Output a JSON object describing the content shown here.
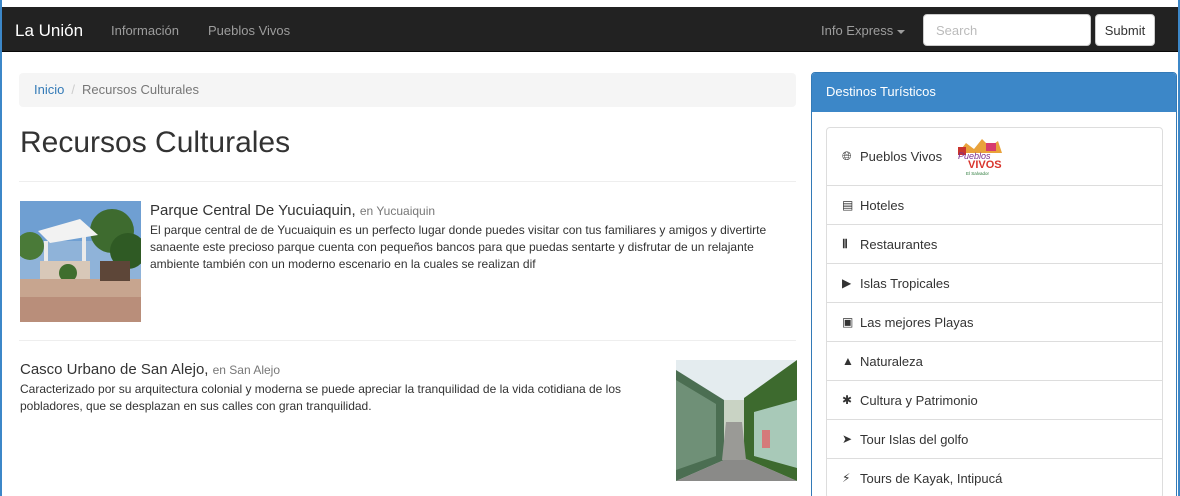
{
  "navbar": {
    "brand": "La Unión",
    "links": [
      "Información",
      "Pueblos Vivos"
    ],
    "dropdown": "Info Express",
    "search_placeholder": "Search",
    "submit": "Submit"
  },
  "breadcrumb": {
    "home": "Inicio",
    "current": "Recursos Culturales"
  },
  "page_title": "Recursos Culturales",
  "items": [
    {
      "title": "Parque Central De Yucuiaquin,",
      "location": "en Yucuaiquin",
      "description": "El parque central de de Yucuaiquin es un perfecto lugar donde puedes visitar con tus familiares y amigos y divertirte sanaente este precioso parque cuenta con pequeños bancos para que puedas sentarte y disfrutar de un relajante ambiente también con un moderno escenario en la cuales se realizan dif"
    },
    {
      "title": "Casco Urbano de San Alejo,",
      "location": "en San Alejo",
      "description": "Caracterizado por su arquitectura colonial y moderna se puede apreciar la tranquilidad de la vida cotidiana de los pobladores, que se desplazan en sus calles con gran tranquilidad."
    }
  ],
  "sidebar": {
    "heading": "Destinos Turísticos",
    "items": [
      {
        "label": "Pueblos Vivos",
        "icon": "globe-icon"
      },
      {
        "label": "Hoteles",
        "icon": "list-alt-icon"
      },
      {
        "label": "Restaurantes",
        "icon": "cutlery-icon"
      },
      {
        "label": "Islas Tropicales",
        "icon": "tags-icon"
      },
      {
        "label": "Las mejores Playas",
        "icon": "picture-icon"
      },
      {
        "label": "Naturaleza",
        "icon": "tree-icon"
      },
      {
        "label": "Cultura y Patrimonio",
        "icon": "asterisk-icon"
      },
      {
        "label": "Tour Islas del golfo",
        "icon": "send-icon"
      },
      {
        "label": "Tours de Kayak, Intipucá",
        "icon": "flash-icon"
      }
    ],
    "logo_text": [
      "Pueblos",
      "VIVOS",
      "El Salvador"
    ]
  },
  "colors": {
    "navbar": "#222222",
    "panel_heading": "#3c87c8",
    "link": "#337ab7"
  }
}
